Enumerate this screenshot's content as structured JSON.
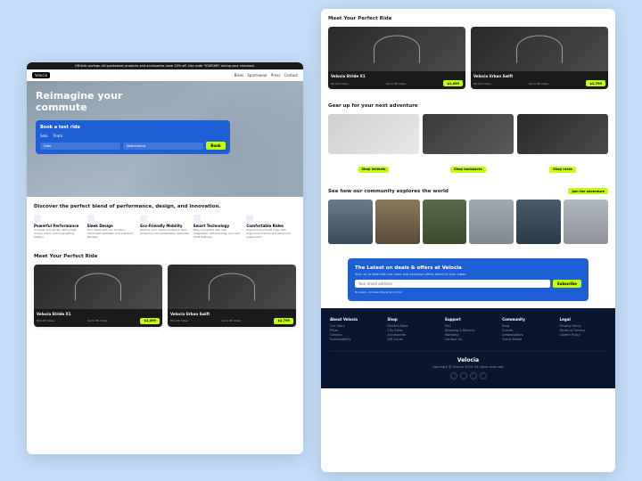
{
  "banner": "Off-kick savings: All sportswear products and accessories have 15% off. Use code 'YOUR365' during your checkout.",
  "nav": {
    "logo": "Velocia",
    "links": [
      "Bikes",
      "Sportswear",
      "Press",
      "Contact"
    ]
  },
  "hero": {
    "title_line1": "Reimagine your",
    "title_line2": "commute"
  },
  "booking": {
    "title": "Book a test ride",
    "tabs": [
      "Solo",
      "Team"
    ],
    "fields": [
      "Date",
      "Netherlands"
    ],
    "btn": "Book"
  },
  "discover": "Discover the perfect blend of performance, design, and innovation.",
  "features": [
    {
      "title": "Powerful Performance",
      "desc": "Conquer any terrain with a high torque motor and long-lasting battery."
    },
    {
      "title": "Sleek Design",
      "desc": "Turn heads with our modern, minimalist aesthetic and premium finishes."
    },
    {
      "title": "Eco-Friendly Mobility",
      "desc": "Reduce your carbon footprint. Zero emissions and sustainable materials."
    },
    {
      "title": "Smart Technology",
      "desc": "Stay connected with app integration, GPS tracking, and anti-theft features."
    },
    {
      "title": "Comfortable Rides",
      "desc": "Experience smooth rides with ergonomic frames and advanced suspension."
    }
  ],
  "meet": {
    "title": "Meet Your Perfect Ride",
    "bikes": [
      {
        "name": "Velocia Stride X1",
        "spec1": "80-120 miles",
        "spec2": "Up to 85 miles",
        "price": "$1,499"
      },
      {
        "name": "Velocia Urban Swift",
        "spec1": "80-120 miles",
        "spec2": "Up to 65 miles",
        "price": "$1,799"
      }
    ]
  },
  "gear": {
    "title": "Gear up for your next adventure",
    "items": [
      "Shop helmets",
      "Shop backpacks",
      "Shop racks"
    ]
  },
  "community": {
    "title": "See how our community explores the world",
    "btn": "Join the adventure"
  },
  "newsletter": {
    "title": "The Latest on deals & offers at Velocia",
    "subtitle": "Stay up to date with our news and exclusive offers direct to your inbox.",
    "placeholder": "Your email address",
    "btn": "Subscribe",
    "note": "No spam. Unsubscribe at any time!"
  },
  "footer": {
    "cols": [
      {
        "title": "About Velocia",
        "links": [
          "Our Story",
          "Press",
          "Careers",
          "Sustainability"
        ]
      },
      {
        "title": "Shop",
        "links": [
          "Electric Bikes",
          "City Bikes",
          "Accessories",
          "Gift Cards"
        ]
      },
      {
        "title": "Support",
        "links": [
          "FAQ",
          "Shipping & Returns",
          "Warranty",
          "Contact Us"
        ]
      },
      {
        "title": "Community",
        "links": [
          "Blog",
          "Events",
          "Ambassadors",
          "Social Media"
        ]
      },
      {
        "title": "Legal",
        "links": [
          "Privacy Policy",
          "Terms of Service",
          "Cookie Policy"
        ]
      }
    ],
    "brand": "Velocia",
    "copy": "Copyright @ Velocia 2024. All rights reserved."
  }
}
